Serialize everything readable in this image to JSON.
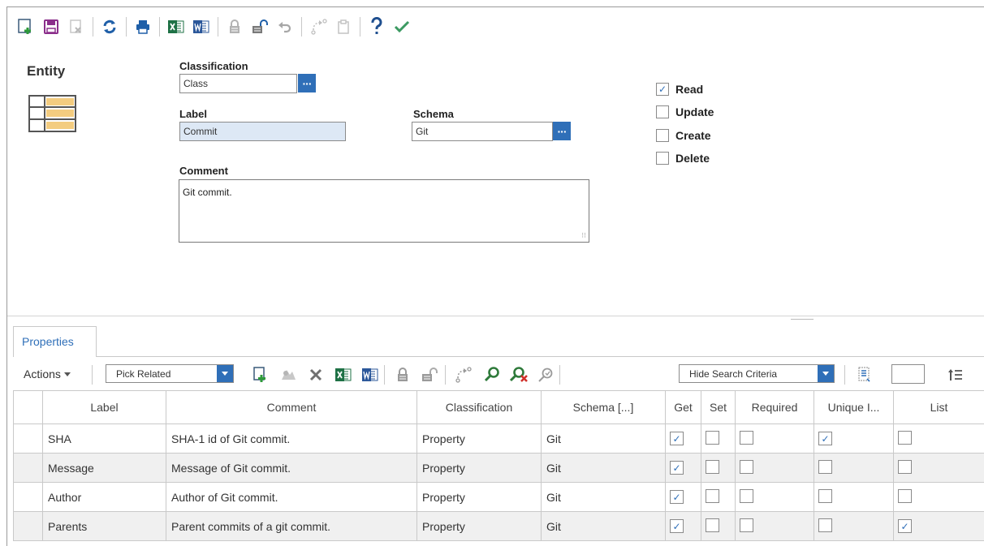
{
  "toolbar": {
    "buttons": [
      {
        "name": "new-document-icon",
        "enabled": true
      },
      {
        "name": "save-icon",
        "enabled": true
      },
      {
        "name": "delete-icon",
        "enabled": false
      },
      {
        "name": "refresh-icon",
        "enabled": true
      },
      {
        "name": "print-icon",
        "enabled": true
      },
      {
        "name": "excel-icon",
        "enabled": true
      },
      {
        "name": "word-icon",
        "enabled": true
      },
      {
        "name": "lock-icon",
        "enabled": false
      },
      {
        "name": "unlock-icon",
        "enabled": true
      },
      {
        "name": "undo-icon",
        "enabled": false
      },
      {
        "name": "promote-icon",
        "enabled": false
      },
      {
        "name": "clipboard-icon",
        "enabled": false
      },
      {
        "name": "help-icon",
        "enabled": true
      },
      {
        "name": "done-icon",
        "enabled": true
      }
    ]
  },
  "form": {
    "title": "Entity",
    "classification_label": "Classification",
    "classification_value": "Class",
    "label_label": "Label",
    "label_value": "Commit",
    "schema_label": "Schema",
    "schema_value": "Git",
    "comment_label": "Comment",
    "comment_value": "Git commit.",
    "ellipsis": "···",
    "permissions": [
      {
        "label": "Read",
        "checked": true
      },
      {
        "label": "Update",
        "checked": false
      },
      {
        "label": "Create",
        "checked": false
      },
      {
        "label": "Delete",
        "checked": false
      }
    ]
  },
  "tabs": {
    "properties": "Properties"
  },
  "grid_toolbar": {
    "actions_label": "Actions",
    "pick_related": "Pick Related",
    "hide_search_criteria": "Hide Search Criteria"
  },
  "grid": {
    "columns": [
      "Label",
      "Comment",
      "Classification",
      "Schema [...]",
      "Get",
      "Set",
      "Required",
      "Unique I...",
      "List"
    ],
    "rows": [
      {
        "label": "SHA",
        "comment": "SHA-1 id of Git commit.",
        "classification": "Property",
        "schema": "Git",
        "get": true,
        "set": false,
        "required": false,
        "unique": true,
        "list": false
      },
      {
        "label": "Message",
        "comment": "Message of Git commit.",
        "classification": "Property",
        "schema": "Git",
        "get": true,
        "set": false,
        "required": false,
        "unique": false,
        "list": false
      },
      {
        "label": "Author",
        "comment": "Author of Git commit.",
        "classification": "Property",
        "schema": "Git",
        "get": true,
        "set": false,
        "required": false,
        "unique": false,
        "list": false
      },
      {
        "label": "Parents",
        "comment": "Parent commits of a git commit.",
        "classification": "Property",
        "schema": "Git",
        "get": true,
        "set": false,
        "required": false,
        "unique": false,
        "list": true
      }
    ]
  },
  "colors": {
    "accent": "#2f6fb8",
    "excel": "#1e7145",
    "word": "#2b579a",
    "save": "#8b2e8b",
    "check": "#3c9a62",
    "highlight_field": "#dde8f5",
    "row_alt": "#f0f0f0"
  }
}
